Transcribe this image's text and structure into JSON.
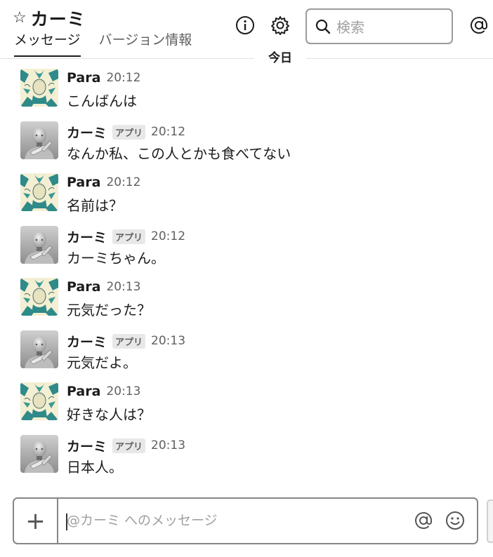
{
  "header": {
    "channel_name": "カーミ",
    "tabs": [
      {
        "label": "メッセージ",
        "active": true
      },
      {
        "label": "バージョン情報",
        "active": false
      }
    ],
    "search_placeholder": "検索",
    "icons": [
      "star-icon",
      "info-icon",
      "gear-icon",
      "search-icon",
      "at-icon"
    ]
  },
  "day_divider": "今日",
  "messages": [
    {
      "sender": "Para",
      "badge": "",
      "time": "20:12",
      "text": "こんばんは",
      "avatar": "para"
    },
    {
      "sender": "カーミ",
      "badge": "アプリ",
      "time": "20:12",
      "text": "なんか私、この人とかも食べてない",
      "avatar": "robot"
    },
    {
      "sender": "Para",
      "badge": "",
      "time": "20:12",
      "text": "名前は？",
      "avatar": "para"
    },
    {
      "sender": "カーミ",
      "badge": "アプリ",
      "time": "20:12",
      "text": "カーミちゃん。",
      "avatar": "robot"
    },
    {
      "sender": "Para",
      "badge": "",
      "time": "20:13",
      "text": "元気だった？",
      "avatar": "para"
    },
    {
      "sender": "カーミ",
      "badge": "アプリ",
      "time": "20:13",
      "text": "元気だよ。",
      "avatar": "robot"
    },
    {
      "sender": "Para",
      "badge": "",
      "time": "20:13",
      "text": "好きな人は？",
      "avatar": "para"
    },
    {
      "sender": "カーミ",
      "badge": "アプリ",
      "time": "20:13",
      "text": "日本人。",
      "avatar": "robot"
    }
  ],
  "composer": {
    "placeholder": "@カーミ へのメッセージ",
    "plus_label": "+"
  },
  "colors": {
    "text": "#1d1c1d",
    "muted": "#616061",
    "para_avatar_teal": "#2f8a8a",
    "para_avatar_cream": "#f3efd2"
  }
}
